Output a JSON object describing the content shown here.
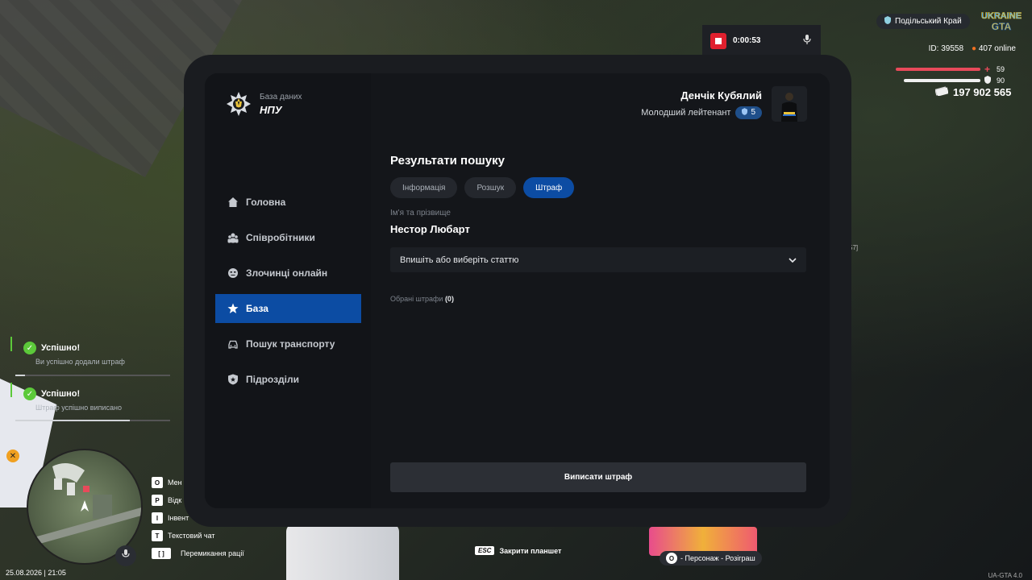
{
  "tablet": {
    "brand_sub": "База даних",
    "brand_title": "НПУ",
    "profile_name": "Денчік Кубялий",
    "profile_rank": "Молодший лейтенант",
    "profile_level": "5"
  },
  "nav": {
    "items": [
      {
        "label": "Головна",
        "icon": "home-icon"
      },
      {
        "label": "Співробітники",
        "icon": "people-icon"
      },
      {
        "label": "Злочинці онлайн",
        "icon": "criminal-icon"
      },
      {
        "label": "База",
        "icon": "star-icon",
        "active": true
      },
      {
        "label": "Пошук транспорту",
        "icon": "car-icon"
      },
      {
        "label": "Підрозділи",
        "icon": "shield-icon"
      }
    ]
  },
  "main": {
    "title": "Результати пошуку",
    "tabs": [
      "Інформація",
      "Розшук",
      "Штраф"
    ],
    "name_label": "Ім'я та прізвище",
    "name_value": "Нестор Любарт",
    "select_placeholder": "Впишіть або виберіть статтю",
    "selected_label": "Обрані штрафи",
    "selected_count": "(0)",
    "submit_label": "Виписати штраф"
  },
  "hud": {
    "rec_time": "0:00:53",
    "region": "Подільський Край",
    "id": "ID: 39558",
    "online": "407 online",
    "health": "59",
    "armor": "90",
    "money": "197 902 565",
    "side_text": "57]"
  },
  "notifications": [
    {
      "title": "Успішно!",
      "text": "Ви успішно додали штраф"
    },
    {
      "title": "Успішно!",
      "text": "Штраф успішно виписано"
    }
  ],
  "keys": [
    {
      "key": "O",
      "label": "Мен"
    },
    {
      "key": "P",
      "label": "Відк"
    },
    {
      "key": "I",
      "label": "Інвент"
    },
    {
      "key": "T",
      "label": "Текстовий чат"
    },
    {
      "key": "[ ]",
      "label": "Перемикання рації"
    }
  ],
  "date": "25.08.2026 | 21:05",
  "esc_key": "ESC",
  "esc_label": "Закрити планшет",
  "promo_label": "- Персонаж - Розіграш",
  "promo_key": "O",
  "version": "UA-GTA 4.0",
  "colors": {
    "accent": "#0c4ca3",
    "success": "#5cc93a",
    "rec": "#e0202e",
    "health": "#e84a5a"
  }
}
